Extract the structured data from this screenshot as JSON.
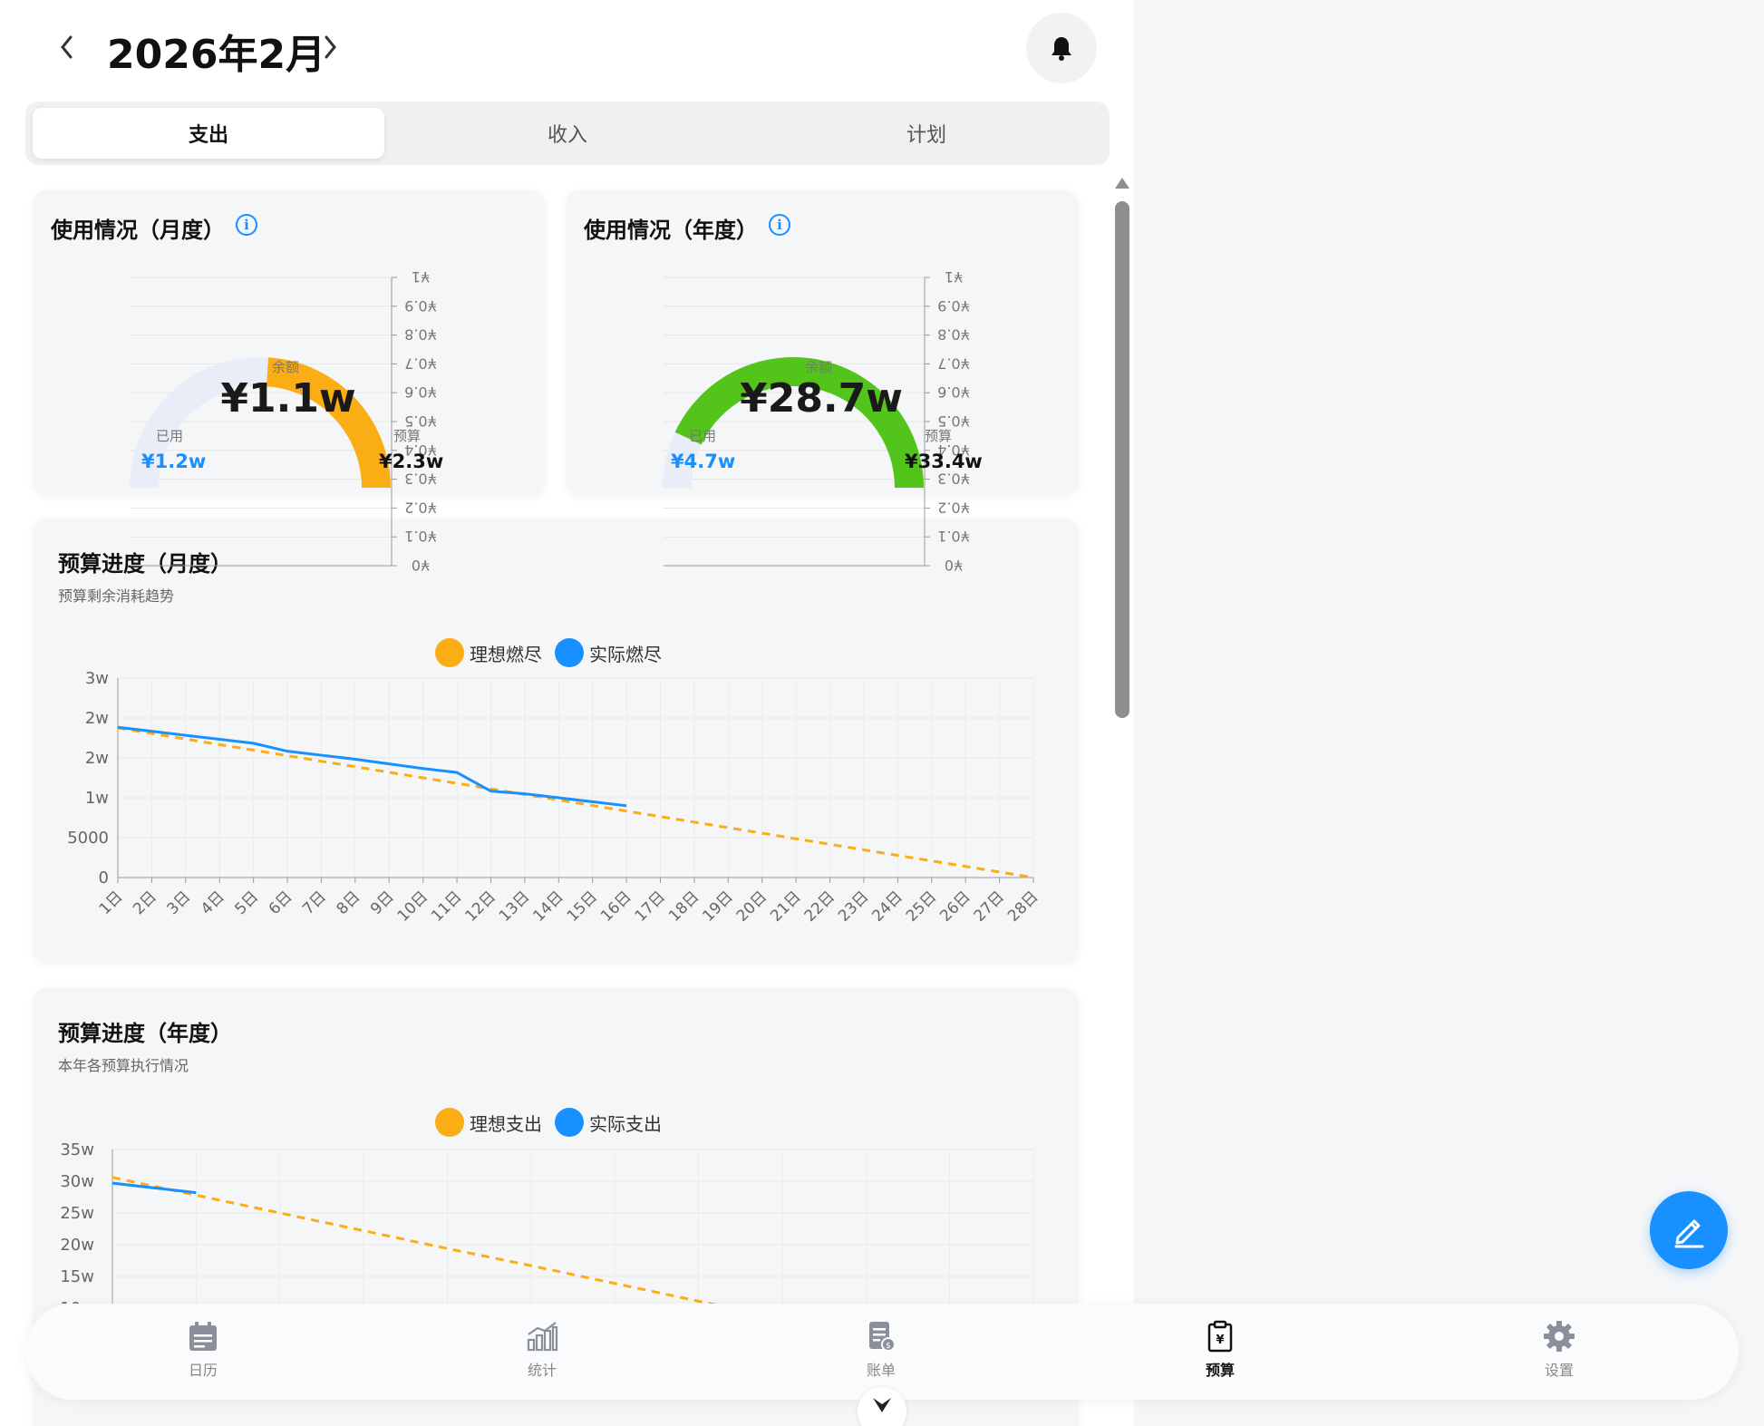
{
  "header": {
    "title": "2026年2月",
    "prev_icon": "chevron-left-icon",
    "next_icon": "chevron-right-icon",
    "bell_icon": "bell-icon"
  },
  "tabs": [
    {
      "label": "支出",
      "active": true
    },
    {
      "label": "收入",
      "active": false
    },
    {
      "label": "计划",
      "active": false
    }
  ],
  "usage_monthly": {
    "title": "使用情况（月度）",
    "remaining_label": "余额",
    "remaining_value": "¥1.1w",
    "used_label": "已用",
    "used_value": "¥1.2w",
    "budget_label": "预算",
    "budget_value": "¥2.3w",
    "used_fraction": 0.52,
    "axis_ticks": [
      "¥1",
      "¥0.9",
      "¥0.8",
      "¥0.7",
      "¥0.6",
      "¥0.5",
      "¥0.4",
      "¥0.3",
      "¥0.2",
      "¥0.1",
      "¥0"
    ],
    "color": "#faad14"
  },
  "usage_yearly": {
    "title": "使用情况（年度）",
    "remaining_label": "余额",
    "remaining_value": "¥28.7w",
    "used_label": "已用",
    "used_value": "¥4.7w",
    "budget_label": "预算",
    "budget_value": "¥33.4w",
    "used_fraction": 0.14,
    "axis_ticks": [
      "¥1",
      "¥0.9",
      "¥0.8",
      "¥0.7",
      "¥0.6",
      "¥0.5",
      "¥0.4",
      "¥0.3",
      "¥0.2",
      "¥0.1",
      "¥0"
    ],
    "color": "#52c41a"
  },
  "monthly_progress": {
    "title": "预算进度（月度）",
    "subtitle": "预算剩余消耗趋势",
    "legend": [
      {
        "name": "理想燃尽",
        "color": "#faad14"
      },
      {
        "name": "实际燃尽",
        "color": "#1890ff"
      }
    ]
  },
  "yearly_progress": {
    "title": "预算进度（年度）",
    "subtitle": "本年各预算执行情况",
    "legend": [
      {
        "name": "理想支出",
        "color": "#faad14"
      },
      {
        "name": "实际支出",
        "color": "#1890ff"
      }
    ]
  },
  "chart_data": [
    {
      "type": "line",
      "chart": "monthly",
      "x": [
        "1日",
        "2日",
        "3日",
        "4日",
        "5日",
        "6日",
        "7日",
        "8日",
        "9日",
        "10日",
        "11日",
        "12日",
        "13日",
        "14日",
        "15日",
        "16日",
        "17日",
        "18日",
        "19日",
        "20日",
        "21日",
        "22日",
        "23日",
        "24日",
        "25日",
        "26日",
        "27日",
        "28日"
      ],
      "y_ticks": [
        "0",
        "5000",
        "1w",
        "2w",
        "2w",
        "3w"
      ],
      "ylim": [
        0,
        25000
      ],
      "series": [
        {
          "name": "理想燃尽",
          "dashed": true,
          "values": [
            22500,
            21667,
            20833,
            20000,
            19167,
            18333,
            17500,
            16667,
            15833,
            15000,
            14167,
            13333,
            12500,
            11667,
            10833,
            10000,
            9167,
            8333,
            7500,
            6667,
            5833,
            5000,
            4167,
            3333,
            2500,
            1667,
            833,
            0
          ]
        },
        {
          "name": "实际燃尽",
          "dashed": false,
          "values": [
            22600,
            22000,
            21400,
            20800,
            20200,
            19000,
            18400,
            17800,
            17100,
            16400,
            15800,
            13000,
            12600,
            12000,
            11400,
            10800,
            null,
            null,
            null,
            null,
            null,
            null,
            null,
            null,
            null,
            null,
            null,
            null
          ]
        }
      ]
    },
    {
      "type": "line",
      "chart": "yearly",
      "y_ticks": [
        "35w",
        "30w",
        "25w",
        "20w",
        "15w",
        "10w"
      ],
      "ylim": [
        0,
        350000
      ],
      "series": [
        {
          "name": "理想支出",
          "dashed": true,
          "values": [
            306000,
            278000,
            250000,
            222000,
            194000,
            167000,
            139000,
            111000,
            83000,
            56000,
            28000,
            0
          ]
        },
        {
          "name": "实际支出",
          "dashed": false,
          "values": [
            297000,
            282000
          ]
        }
      ]
    }
  ],
  "nav": [
    {
      "label": "日历",
      "icon": "calendar-icon",
      "active": false
    },
    {
      "label": "统计",
      "icon": "chart-icon",
      "active": false
    },
    {
      "label": "账单",
      "icon": "bill-icon",
      "active": false
    },
    {
      "label": "预算",
      "icon": "budget-icon",
      "active": true
    },
    {
      "label": "设置",
      "icon": "gear-icon",
      "active": false
    }
  ],
  "fab": {
    "icon": "edit-icon"
  }
}
